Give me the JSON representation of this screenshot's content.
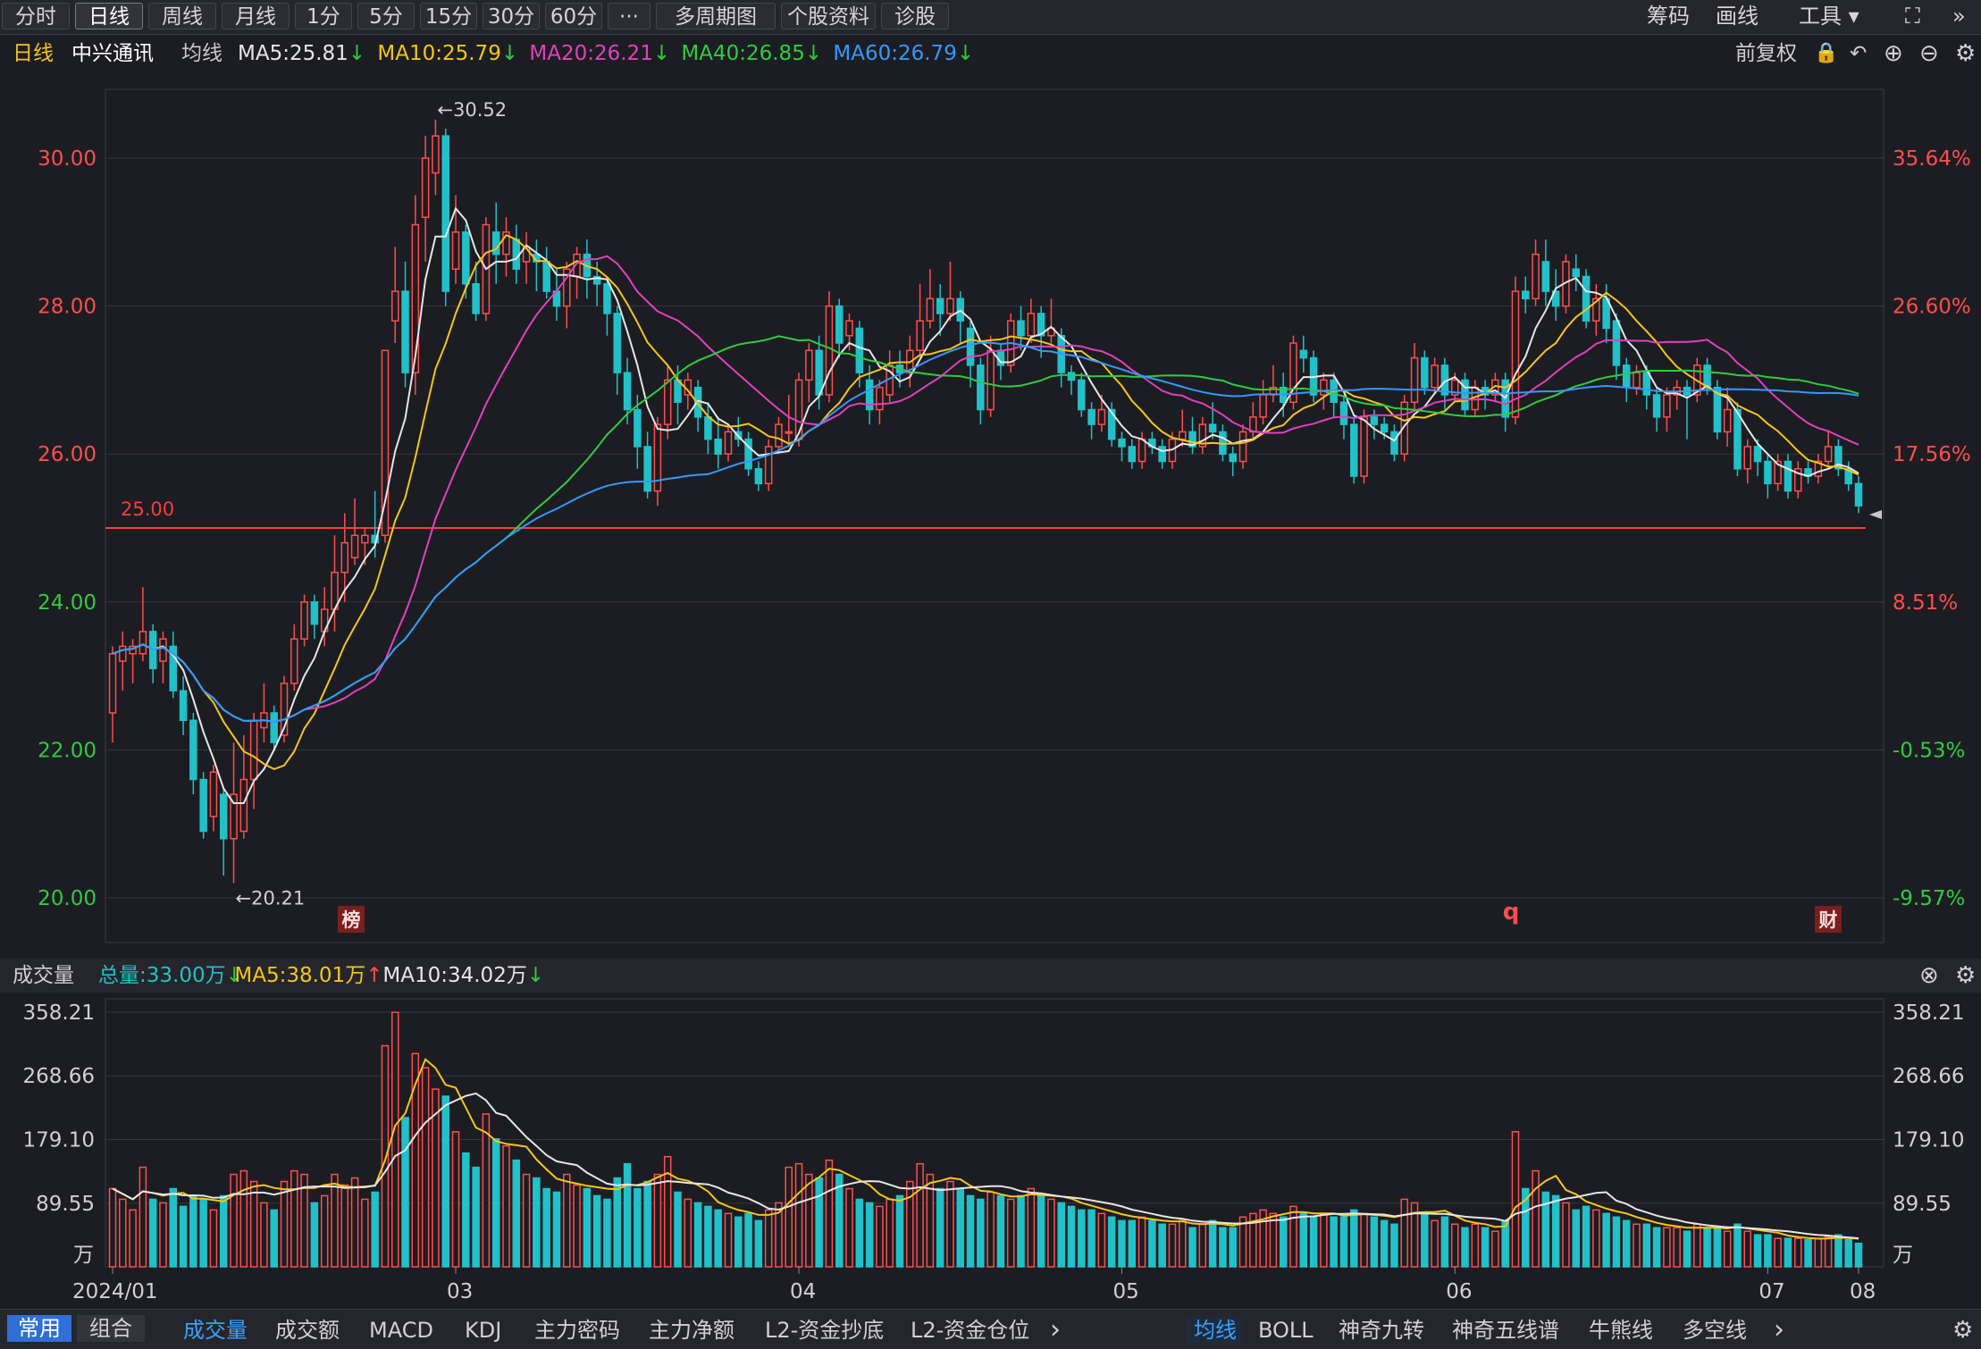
{
  "toolbar": {
    "tabs": [
      "分时",
      "日线",
      "周线",
      "月线",
      "1分",
      "5分",
      "15分",
      "30分",
      "60分",
      "···",
      "多周期图",
      "个股资料",
      "诊股"
    ],
    "active_tab": "日线",
    "right_buttons": [
      "筹码",
      "画线",
      "工具"
    ]
  },
  "ma_header": {
    "period": "日线",
    "stock_name": "中兴通讯",
    "ma_label": "均线",
    "items": [
      {
        "text": "MA5:25.81",
        "color": "#e6e6e6",
        "arrow": "down"
      },
      {
        "text": "MA10:25.79",
        "color": "#f5c518",
        "arrow": "down"
      },
      {
        "text": "MA20:26.21",
        "color": "#e040c0",
        "arrow": "down"
      },
      {
        "text": "MA40:26.85",
        "color": "#2ecc40",
        "arrow": "down"
      },
      {
        "text": "MA60:26.79",
        "color": "#3399ff",
        "arrow": "down"
      }
    ],
    "adjust": "前复权"
  },
  "volume_header": {
    "label": "成交量",
    "items": [
      {
        "text": "总量:33.00万",
        "color": "#22c0c8",
        "arrow": "down"
      },
      {
        "text": "MA5:38.01万",
        "color": "#f5c518",
        "arrow": "up"
      },
      {
        "text": "MA10:34.02万",
        "color": "#e6e6e6",
        "arrow": "down"
      }
    ]
  },
  "price_axis": {
    "left_ticks": [
      "30.00",
      "28.00",
      "26.00",
      "24.00",
      "22.00",
      "20.00"
    ],
    "right_ticks": [
      "35.64%",
      "26.60%",
      "17.56%",
      "8.51%",
      "-0.53%",
      "-9.57%"
    ],
    "high_label": "←30.52",
    "low_label": "←20.21",
    "ref_line_label": "25.00",
    "markers": [
      "榜",
      "q",
      "财"
    ]
  },
  "volume_axis": {
    "ticks": [
      "358.21",
      "268.66",
      "179.10",
      "89.55"
    ],
    "unit": "万"
  },
  "x_axis": {
    "labels": [
      "2024/01",
      "03",
      "04",
      "05",
      "06",
      "07",
      "08"
    ]
  },
  "bottom_tabs": {
    "left": [
      "常用",
      "组合"
    ],
    "indicators": [
      "成交量",
      "成交额",
      "MACD",
      "KDJ",
      "主力密码",
      "主力净额",
      "L2-资金抄底",
      "L2-资金仓位"
    ],
    "overlays": [
      "均线",
      "BOLL",
      "神奇九转",
      "神奇五线谱",
      "牛熊线",
      "多空线"
    ]
  },
  "colors": {
    "up": "#ff4d4d",
    "down": "#22c0c8",
    "bg": "#1c1d22",
    "grid": "#34353b",
    "ref": "#ff3b3b"
  },
  "chart_data": {
    "type": "candlestick",
    "title": "中兴通讯 日线",
    "price_range": [
      20.0,
      30.52
    ],
    "reference_price": 25.0,
    "volume_unit": "万",
    "candles": [
      [
        22.5,
        23.3,
        23.4,
        22.1,
        110
      ],
      [
        23.2,
        23.4,
        23.6,
        22.8,
        95
      ],
      [
        23.3,
        23.4,
        23.5,
        22.9,
        80
      ],
      [
        23.3,
        23.6,
        24.2,
        23.2,
        140
      ],
      [
        23.6,
        23.1,
        23.7,
        22.9,
        95
      ],
      [
        23.2,
        23.5,
        23.6,
        22.9,
        90
      ],
      [
        23.4,
        22.8,
        23.6,
        22.7,
        110
      ],
      [
        22.8,
        22.4,
        23.0,
        22.2,
        85
      ],
      [
        22.4,
        21.6,
        22.5,
        21.4,
        100
      ],
      [
        21.6,
        20.9,
        21.7,
        20.8,
        95
      ],
      [
        21.1,
        21.7,
        21.8,
        20.9,
        80
      ],
      [
        21.4,
        20.8,
        21.5,
        20.3,
        100
      ],
      [
        20.8,
        21.4,
        22.1,
        20.2,
        130
      ],
      [
        20.9,
        21.6,
        22.2,
        20.8,
        135
      ],
      [
        21.6,
        22.4,
        22.5,
        21.2,
        120
      ],
      [
        22.3,
        22.5,
        22.9,
        22.1,
        90
      ],
      [
        22.5,
        22.1,
        22.6,
        22.0,
        80
      ],
      [
        22.2,
        22.9,
        23.0,
        22.1,
        120
      ],
      [
        22.9,
        23.5,
        23.7,
        22.8,
        135
      ],
      [
        23.5,
        24.0,
        24.1,
        23.4,
        130
      ],
      [
        24.0,
        23.7,
        24.1,
        23.5,
        90
      ],
      [
        23.6,
        23.9,
        24.2,
        23.4,
        100
      ],
      [
        23.9,
        24.4,
        24.9,
        23.6,
        130
      ],
      [
        24.4,
        24.8,
        25.2,
        24.0,
        115
      ],
      [
        24.6,
        24.9,
        25.4,
        24.5,
        125
      ],
      [
        24.8,
        24.9,
        25.0,
        24.5,
        95
      ],
      [
        24.9,
        24.8,
        25.5,
        24.6,
        105
      ],
      [
        24.9,
        27.4,
        27.4,
        24.8,
        311
      ],
      [
        27.8,
        28.2,
        28.8,
        27.5,
        358
      ],
      [
        28.2,
        27.1,
        28.6,
        26.9,
        210
      ],
      [
        27.1,
        29.1,
        29.5,
        26.8,
        300
      ],
      [
        29.2,
        30.0,
        30.3,
        28.6,
        280
      ],
      [
        29.8,
        30.3,
        30.52,
        29.5,
        250
      ],
      [
        30.3,
        28.2,
        30.4,
        28.0,
        240
      ],
      [
        28.5,
        29.0,
        29.5,
        28.3,
        190
      ],
      [
        29.0,
        28.3,
        29.1,
        28.1,
        160
      ],
      [
        28.3,
        27.9,
        28.6,
        27.8,
        140
      ],
      [
        27.9,
        29.1,
        29.2,
        27.8,
        215
      ],
      [
        29.0,
        28.7,
        29.4,
        28.3,
        180
      ],
      [
        28.7,
        29.0,
        29.2,
        28.4,
        170
      ],
      [
        28.9,
        28.5,
        29.1,
        28.3,
        150
      ],
      [
        28.6,
        28.8,
        29.0,
        28.3,
        130
      ],
      [
        28.7,
        28.6,
        28.9,
        28.2,
        125
      ],
      [
        28.6,
        28.2,
        28.8,
        28.1,
        110
      ],
      [
        28.2,
        28.0,
        28.5,
        27.8,
        105
      ],
      [
        28.0,
        28.5,
        28.6,
        27.7,
        130
      ],
      [
        28.4,
        28.7,
        28.8,
        28.1,
        115
      ],
      [
        28.7,
        28.4,
        28.9,
        28.1,
        110
      ],
      [
        28.4,
        28.3,
        28.6,
        28.0,
        100
      ],
      [
        28.3,
        27.9,
        28.4,
        27.6,
        95
      ],
      [
        27.9,
        27.1,
        28.0,
        26.8,
        125
      ],
      [
        27.1,
        26.6,
        27.3,
        26.4,
        145
      ],
      [
        26.6,
        26.1,
        26.8,
        25.8,
        110
      ],
      [
        26.1,
        25.5,
        26.3,
        25.4,
        120
      ],
      [
        25.5,
        26.4,
        26.5,
        25.3,
        130
      ],
      [
        26.4,
        27.0,
        27.2,
        26.2,
        155
      ],
      [
        27.0,
        26.7,
        27.2,
        26.4,
        105
      ],
      [
        26.8,
        27.0,
        27.1,
        26.6,
        95
      ],
      [
        26.9,
        26.5,
        27.0,
        26.3,
        90
      ],
      [
        26.5,
        26.2,
        26.7,
        26.0,
        85
      ],
      [
        26.2,
        26.0,
        26.5,
        25.8,
        80
      ],
      [
        26.0,
        26.3,
        26.4,
        25.9,
        75
      ],
      [
        26.3,
        26.2,
        26.5,
        26.1,
        70
      ],
      [
        26.2,
        25.8,
        26.3,
        25.7,
        75
      ],
      [
        25.8,
        25.6,
        25.9,
        25.5,
        65
      ],
      [
        25.6,
        26.1,
        26.2,
        25.5,
        80
      ],
      [
        26.1,
        26.4,
        26.5,
        26.0,
        90
      ],
      [
        26.3,
        26.3,
        26.8,
        26.1,
        140
      ],
      [
        26.2,
        27.0,
        27.1,
        26.1,
        145
      ],
      [
        27.0,
        27.4,
        27.5,
        26.7,
        130
      ],
      [
        27.4,
        26.8,
        27.6,
        26.6,
        125
      ],
      [
        26.8,
        28.0,
        28.2,
        26.7,
        150
      ],
      [
        28.0,
        27.5,
        28.1,
        27.3,
        130
      ],
      [
        27.6,
        27.8,
        27.9,
        27.4,
        110
      ],
      [
        27.7,
        27.1,
        27.8,
        26.9,
        95
      ],
      [
        27.0,
        26.6,
        27.2,
        26.4,
        90
      ],
      [
        26.6,
        26.9,
        27.0,
        26.4,
        85
      ],
      [
        26.8,
        27.2,
        27.4,
        26.7,
        95
      ],
      [
        27.2,
        27.1,
        27.4,
        26.9,
        100
      ],
      [
        27.1,
        27.4,
        27.6,
        26.9,
        120
      ],
      [
        27.4,
        27.8,
        28.3,
        27.3,
        145
      ],
      [
        27.8,
        28.1,
        28.5,
        27.7,
        130
      ],
      [
        28.1,
        27.9,
        28.3,
        27.6,
        110
      ],
      [
        27.9,
        28.1,
        28.6,
        27.8,
        120
      ],
      [
        28.1,
        27.8,
        28.2,
        27.5,
        110
      ],
      [
        27.7,
        27.2,
        27.8,
        26.9,
        100
      ],
      [
        27.2,
        26.6,
        27.3,
        26.4,
        95
      ],
      [
        26.6,
        27.4,
        27.6,
        26.5,
        105
      ],
      [
        27.4,
        27.2,
        27.5,
        27.0,
        100
      ],
      [
        27.2,
        27.8,
        27.9,
        27.1,
        95
      ],
      [
        27.8,
        27.6,
        28.0,
        27.4,
        100
      ],
      [
        27.6,
        27.9,
        28.1,
        27.5,
        110
      ],
      [
        27.9,
        27.6,
        28.0,
        27.3,
        100
      ],
      [
        27.6,
        27.7,
        28.1,
        27.5,
        95
      ],
      [
        27.6,
        27.1,
        27.7,
        26.9,
        90
      ],
      [
        27.1,
        27.0,
        27.2,
        26.8,
        85
      ],
      [
        27.0,
        26.6,
        27.1,
        26.5,
        80
      ],
      [
        26.6,
        26.4,
        26.7,
        26.2,
        80
      ],
      [
        26.4,
        26.6,
        26.8,
        26.3,
        75
      ],
      [
        26.6,
        26.2,
        26.7,
        26.1,
        70
      ],
      [
        26.2,
        26.1,
        26.3,
        25.9,
        65
      ],
      [
        26.1,
        25.9,
        26.2,
        25.8,
        65
      ],
      [
        25.9,
        26.2,
        26.3,
        25.8,
        70
      ],
      [
        26.2,
        26.1,
        26.3,
        26.0,
        65
      ],
      [
        26.1,
        25.9,
        26.2,
        25.8,
        60
      ],
      [
        25.9,
        26.2,
        26.3,
        25.8,
        60
      ],
      [
        26.2,
        26.3,
        26.6,
        26.1,
        65
      ],
      [
        26.3,
        26.1,
        26.5,
        26.0,
        55
      ],
      [
        26.1,
        26.4,
        26.5,
        26.0,
        60
      ],
      [
        26.4,
        26.3,
        26.7,
        26.2,
        65
      ],
      [
        26.3,
        26.0,
        26.4,
        25.9,
        55
      ],
      [
        26.0,
        25.9,
        26.1,
        25.7,
        55
      ],
      [
        25.9,
        26.3,
        26.4,
        25.8,
        70
      ],
      [
        26.3,
        26.5,
        26.7,
        26.2,
        75
      ],
      [
        26.5,
        26.8,
        27.0,
        26.4,
        80
      ],
      [
        26.8,
        26.9,
        27.2,
        26.7,
        75
      ],
      [
        26.9,
        26.7,
        27.1,
        26.5,
        70
      ],
      [
        26.7,
        27.5,
        27.6,
        26.6,
        85
      ],
      [
        27.4,
        27.3,
        27.6,
        27.1,
        75
      ],
      [
        27.3,
        26.8,
        27.4,
        26.7,
        70
      ],
      [
        26.8,
        27.0,
        27.1,
        26.6,
        75
      ],
      [
        27.0,
        26.7,
        27.1,
        26.5,
        70
      ],
      [
        26.7,
        26.4,
        26.8,
        26.2,
        70
      ],
      [
        26.4,
        25.7,
        26.5,
        25.6,
        80
      ],
      [
        25.7,
        26.5,
        26.6,
        25.6,
        75
      ],
      [
        26.5,
        26.4,
        26.6,
        26.2,
        70
      ],
      [
        26.4,
        26.3,
        26.5,
        26.2,
        65
      ],
      [
        26.3,
        26.0,
        26.4,
        25.9,
        60
      ],
      [
        26.0,
        26.7,
        26.8,
        25.9,
        95
      ],
      [
        26.7,
        27.3,
        27.5,
        26.6,
        90
      ],
      [
        27.3,
        26.9,
        27.4,
        26.8,
        75
      ],
      [
        26.9,
        27.2,
        27.3,
        26.8,
        65
      ],
      [
        27.2,
        26.8,
        27.3,
        26.6,
        70
      ],
      [
        26.8,
        27.0,
        27.1,
        26.7,
        60
      ],
      [
        27.0,
        26.6,
        27.1,
        26.5,
        55
      ],
      [
        26.6,
        26.9,
        27.0,
        26.5,
        60
      ],
      [
        26.9,
        26.8,
        27.0,
        26.6,
        55
      ],
      [
        26.8,
        27.0,
        27.1,
        26.7,
        50
      ],
      [
        27.0,
        26.5,
        27.1,
        26.3,
        65
      ],
      [
        26.5,
        28.2,
        28.4,
        26.4,
        190
      ],
      [
        28.2,
        28.1,
        28.4,
        27.9,
        110
      ],
      [
        28.1,
        28.7,
        28.9,
        28.0,
        135
      ],
      [
        28.6,
        28.2,
        28.9,
        28.0,
        105
      ],
      [
        28.2,
        28.0,
        28.5,
        27.8,
        100
      ],
      [
        28.0,
        28.6,
        28.7,
        27.9,
        90
      ],
      [
        28.5,
        28.4,
        28.7,
        28.2,
        80
      ],
      [
        28.4,
        27.8,
        28.5,
        27.7,
        85
      ],
      [
        27.8,
        28.1,
        28.3,
        27.6,
        80
      ],
      [
        28.1,
        27.7,
        28.3,
        27.5,
        75
      ],
      [
        27.8,
        27.2,
        27.9,
        27.0,
        70
      ],
      [
        27.2,
        26.9,
        27.3,
        26.7,
        65
      ],
      [
        26.9,
        27.1,
        27.2,
        26.8,
        60
      ],
      [
        27.1,
        26.8,
        27.2,
        26.6,
        60
      ],
      [
        26.8,
        26.5,
        26.9,
        26.3,
        55
      ],
      [
        26.5,
        26.8,
        26.9,
        26.3,
        55
      ],
      [
        26.8,
        26.9,
        27.0,
        26.6,
        55
      ],
      [
        26.9,
        26.8,
        27.0,
        26.2,
        50
      ],
      [
        26.8,
        27.2,
        27.3,
        26.7,
        60
      ],
      [
        27.2,
        26.9,
        27.3,
        26.8,
        55
      ],
      [
        26.9,
        26.3,
        27.0,
        26.2,
        55
      ],
      [
        26.3,
        26.6,
        26.9,
        26.1,
        50
      ],
      [
        26.6,
        25.8,
        26.7,
        25.7,
        60
      ],
      [
        25.8,
        26.1,
        26.2,
        25.6,
        50
      ],
      [
        26.1,
        25.9,
        26.2,
        25.7,
        45
      ],
      [
        25.9,
        25.6,
        26.0,
        25.4,
        45
      ],
      [
        25.6,
        25.9,
        26.0,
        25.5,
        40
      ],
      [
        25.9,
        25.5,
        26.0,
        25.4,
        40
      ],
      [
        25.5,
        25.8,
        25.9,
        25.4,
        40
      ],
      [
        25.8,
        25.7,
        25.9,
        25.6,
        38
      ],
      [
        25.7,
        25.9,
        26.0,
        25.6,
        40
      ],
      [
        25.9,
        26.1,
        26.3,
        25.8,
        42
      ],
      [
        26.1,
        25.8,
        26.2,
        25.7,
        45
      ],
      [
        25.8,
        25.6,
        25.9,
        25.5,
        38
      ],
      [
        25.6,
        25.3,
        25.7,
        25.2,
        33
      ]
    ]
  }
}
